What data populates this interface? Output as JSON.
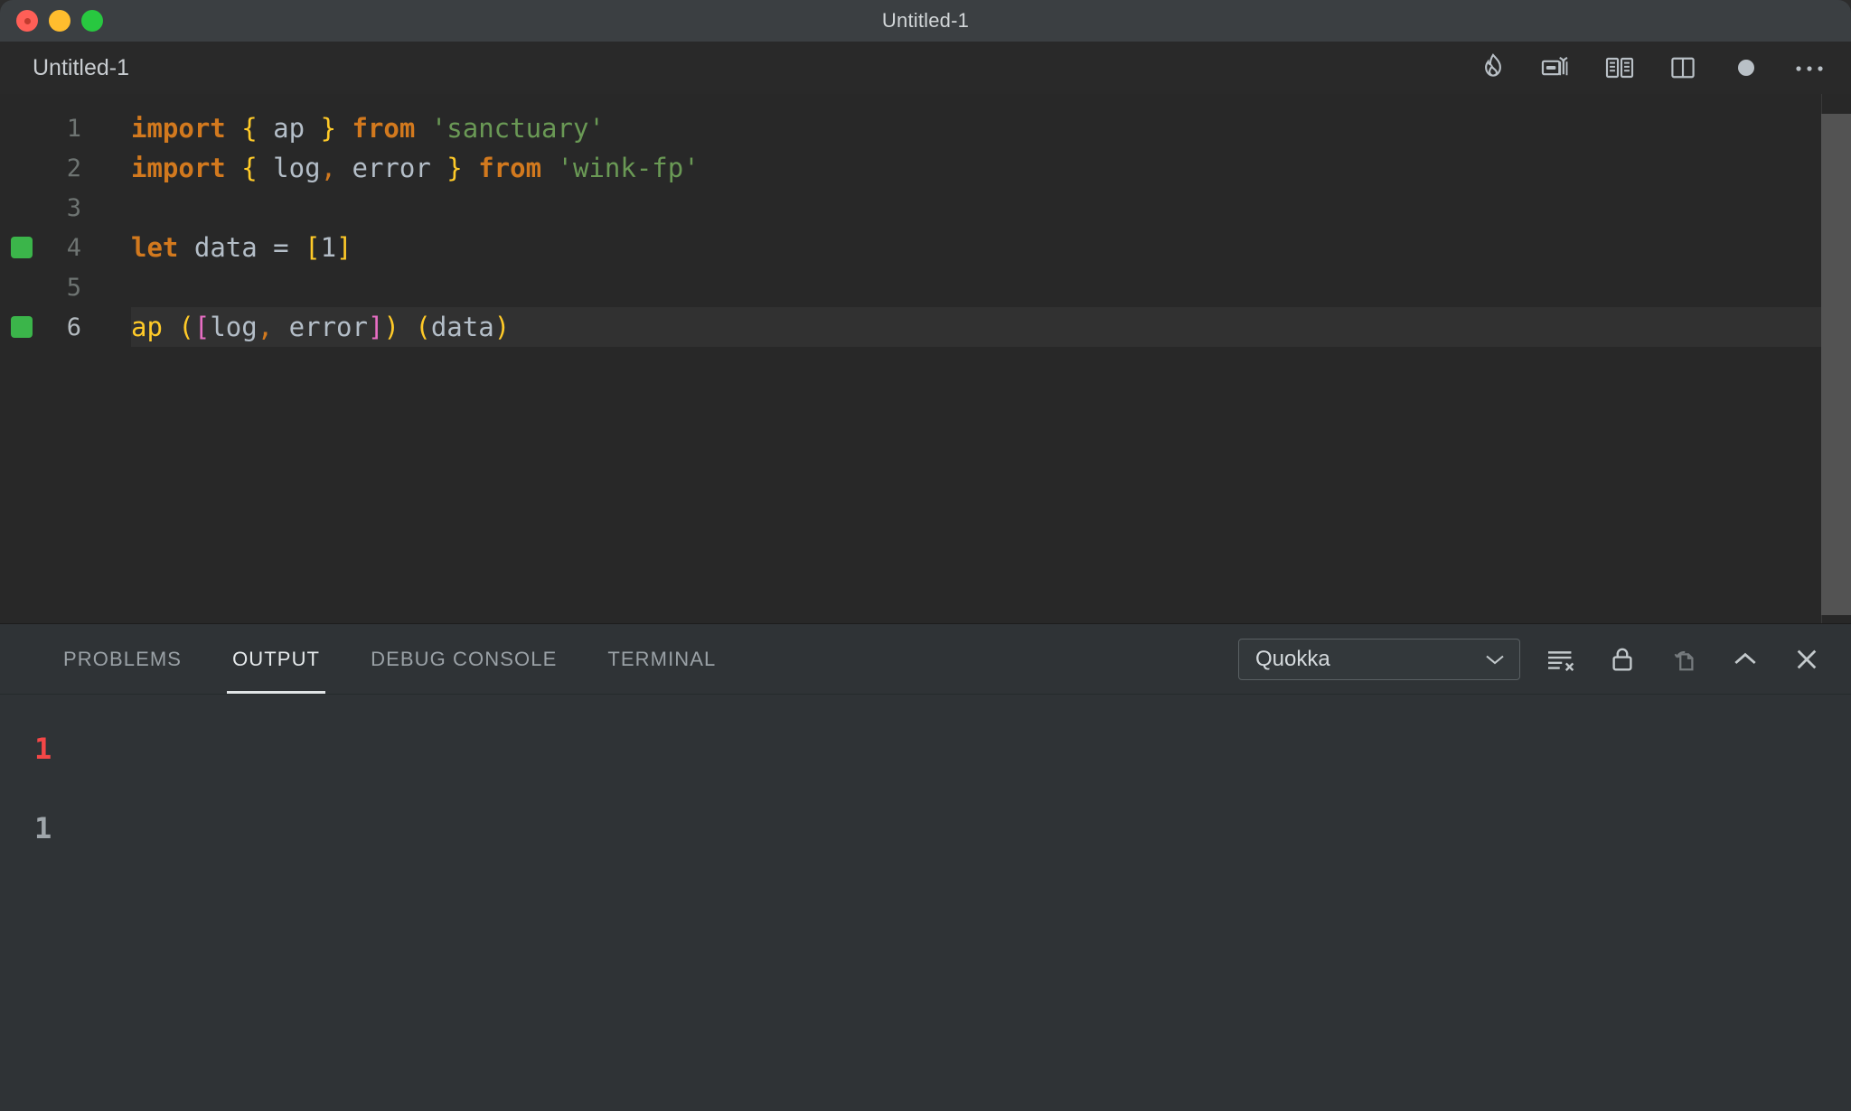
{
  "window": {
    "title": "Untitled-1",
    "traffic_lights": [
      "close",
      "minimize",
      "maximize"
    ]
  },
  "editor": {
    "tab_title": "Untitled-1",
    "actions": [
      {
        "name": "quokka-flame-icon",
        "label": "Quokka"
      },
      {
        "name": "run-preview-icon",
        "label": "Run Current File"
      },
      {
        "name": "open-preview-icon",
        "label": "Open Preview"
      },
      {
        "name": "split-editor-icon",
        "label": "Split Editor"
      },
      {
        "name": "unsaved-dot-icon",
        "label": "Unsaved"
      },
      {
        "name": "more-actions-icon",
        "label": "More Actions..."
      }
    ],
    "lines": [
      {
        "number": "1",
        "marker": false,
        "active": false,
        "tokens": [
          {
            "t": "import",
            "c": "kw"
          },
          {
            "t": " ",
            "c": "op"
          },
          {
            "t": "{",
            "c": "brace"
          },
          {
            "t": " ",
            "c": "op"
          },
          {
            "t": "ap",
            "c": "ident"
          },
          {
            "t": " ",
            "c": "op"
          },
          {
            "t": "}",
            "c": "brace"
          },
          {
            "t": " ",
            "c": "op"
          },
          {
            "t": "from",
            "c": "kw"
          },
          {
            "t": " ",
            "c": "op"
          },
          {
            "t": "'sanctuary'",
            "c": "str"
          }
        ]
      },
      {
        "number": "2",
        "marker": false,
        "active": false,
        "tokens": [
          {
            "t": "import",
            "c": "kw"
          },
          {
            "t": " ",
            "c": "op"
          },
          {
            "t": "{",
            "c": "brace"
          },
          {
            "t": " ",
            "c": "op"
          },
          {
            "t": "log",
            "c": "ident"
          },
          {
            "t": ",",
            "c": "comma"
          },
          {
            "t": " ",
            "c": "op"
          },
          {
            "t": "error",
            "c": "ident"
          },
          {
            "t": " ",
            "c": "op"
          },
          {
            "t": "}",
            "c": "brace"
          },
          {
            "t": " ",
            "c": "op"
          },
          {
            "t": "from",
            "c": "kw"
          },
          {
            "t": " ",
            "c": "op"
          },
          {
            "t": "'wink-fp'",
            "c": "str"
          }
        ]
      },
      {
        "number": "3",
        "marker": false,
        "active": false,
        "tokens": []
      },
      {
        "number": "4",
        "marker": true,
        "active": false,
        "tokens": [
          {
            "t": "let",
            "c": "kw"
          },
          {
            "t": " ",
            "c": "op"
          },
          {
            "t": "data",
            "c": "ident"
          },
          {
            "t": " ",
            "c": "op"
          },
          {
            "t": "=",
            "c": "op"
          },
          {
            "t": " ",
            "c": "op"
          },
          {
            "t": "[",
            "c": "brace"
          },
          {
            "t": "1",
            "c": "num"
          },
          {
            "t": "]",
            "c": "brace"
          }
        ]
      },
      {
        "number": "5",
        "marker": false,
        "active": false,
        "tokens": []
      },
      {
        "number": "6",
        "marker": true,
        "active": true,
        "tokens": [
          {
            "t": "ap",
            "c": "fn"
          },
          {
            "t": " ",
            "c": "op"
          },
          {
            "t": "(",
            "c": "b1"
          },
          {
            "t": "[",
            "c": "b2"
          },
          {
            "t": "log",
            "c": "ident"
          },
          {
            "t": ",",
            "c": "comma"
          },
          {
            "t": " ",
            "c": "op"
          },
          {
            "t": "error",
            "c": "ident"
          },
          {
            "t": "]",
            "c": "b2"
          },
          {
            "t": ")",
            "c": "b1"
          },
          {
            "t": " ",
            "c": "op"
          },
          {
            "t": "(",
            "c": "b1"
          },
          {
            "t": "data",
            "c": "ident"
          },
          {
            "t": ")",
            "c": "b1"
          }
        ]
      }
    ]
  },
  "panel": {
    "tabs": [
      {
        "label": "PROBLEMS",
        "active": false
      },
      {
        "label": "OUTPUT",
        "active": true
      },
      {
        "label": "DEBUG CONSOLE",
        "active": false
      },
      {
        "label": "TERMINAL",
        "active": false
      }
    ],
    "channel_selector": {
      "value": "Quokka",
      "options": [
        "Quokka"
      ]
    },
    "actions": [
      {
        "name": "clear-output-icon",
        "label": "Clear Output",
        "dim": false
      },
      {
        "name": "lock-scroll-icon",
        "label": "Turn Auto Scrolling Off",
        "dim": false
      },
      {
        "name": "open-in-editor-icon",
        "label": "Open Output in Editor",
        "dim": true
      },
      {
        "name": "maximize-panel-icon",
        "label": "Maximize Panel Size",
        "dim": false
      },
      {
        "name": "close-panel-icon",
        "label": "Close Panel",
        "dim": false
      }
    ],
    "output_lines": [
      {
        "text": "1",
        "kind": "err"
      },
      {
        "text": "1",
        "kind": "info"
      }
    ]
  },
  "colors": {
    "keyword": "#d2791e",
    "string": "#6a9955",
    "identifier": "#b4bec8",
    "brace_yellow": "#ffca28",
    "bracket_pink": "#e86ec4",
    "error_red": "#f44747",
    "quokka_green": "#3bb54a"
  }
}
